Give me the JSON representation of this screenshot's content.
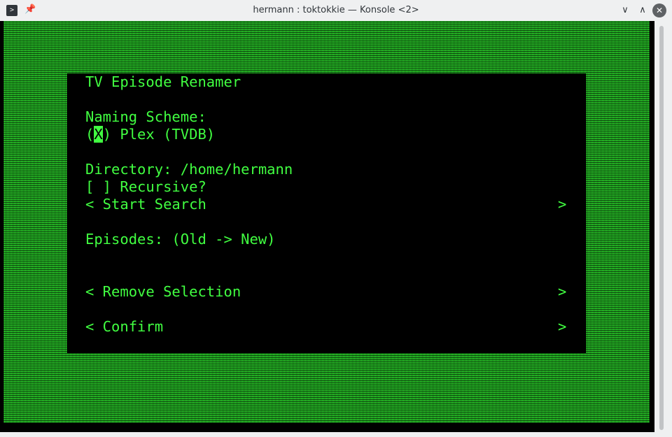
{
  "window": {
    "title": "hermann : toktokkie — Konsole <2>",
    "app_icon": "terminal-prompt-icon",
    "pin_icon": "pin-icon",
    "min_glyph": "∨",
    "max_glyph": "∧",
    "close_glyph": "✕"
  },
  "colors": {
    "terminal_fg": "#41ff41",
    "terminal_bg": "#000000",
    "pattern": "#2bd72b"
  },
  "dialog": {
    "heading": "TV Episode Renamer",
    "naming_label": "Naming Scheme:",
    "radio_open": "(",
    "radio_mark": "X",
    "radio_close": ") Plex (TVDB)",
    "directory": "Directory: /home/hermann",
    "recursive": "[ ] Recursive?",
    "start_search": "< Start Search",
    "start_search_arrow": ">",
    "episodes": "Episodes: (Old -> New)",
    "remove_selection": "< Remove Selection",
    "remove_selection_arrow": ">",
    "confirm": "< Confirm",
    "confirm_arrow": ">"
  }
}
